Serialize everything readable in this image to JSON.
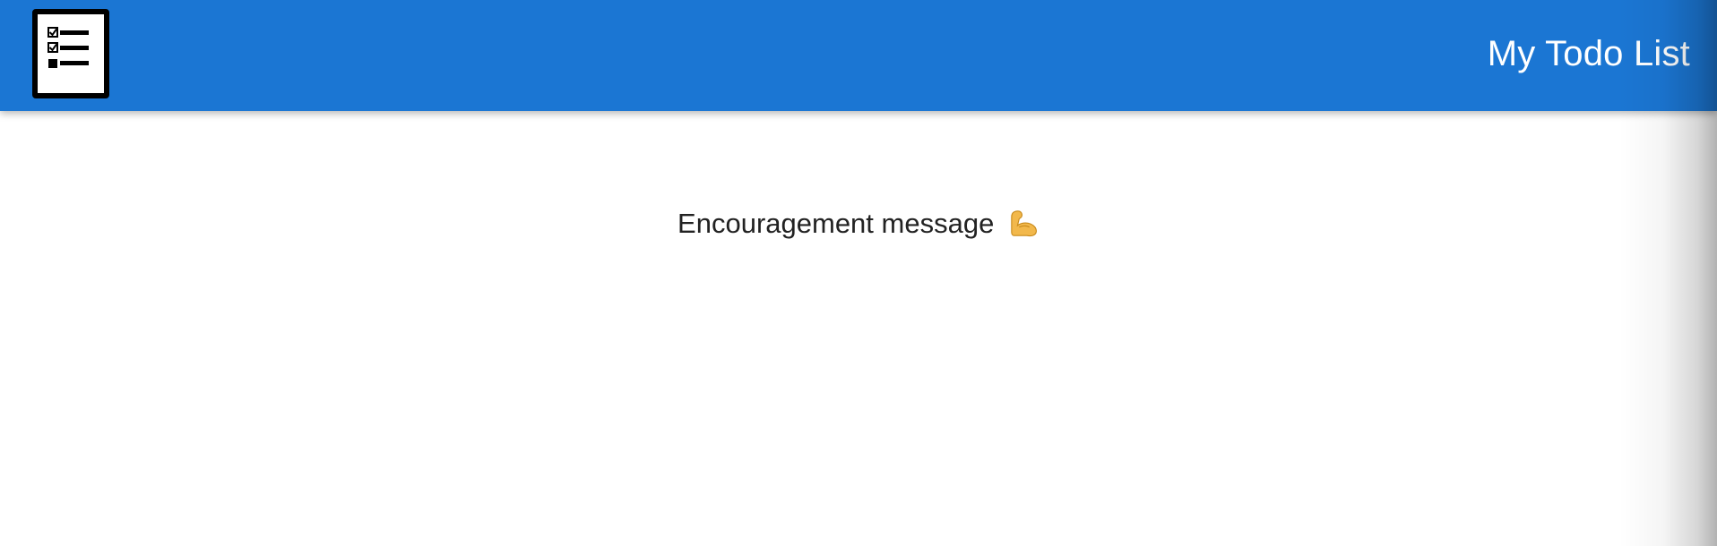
{
  "header": {
    "logo_icon": "checklist-icon",
    "title": "My Todo List",
    "background_color": "#1b76d3"
  },
  "main": {
    "message": "Encouragement message",
    "message_icon": "flexed-biceps-icon"
  }
}
